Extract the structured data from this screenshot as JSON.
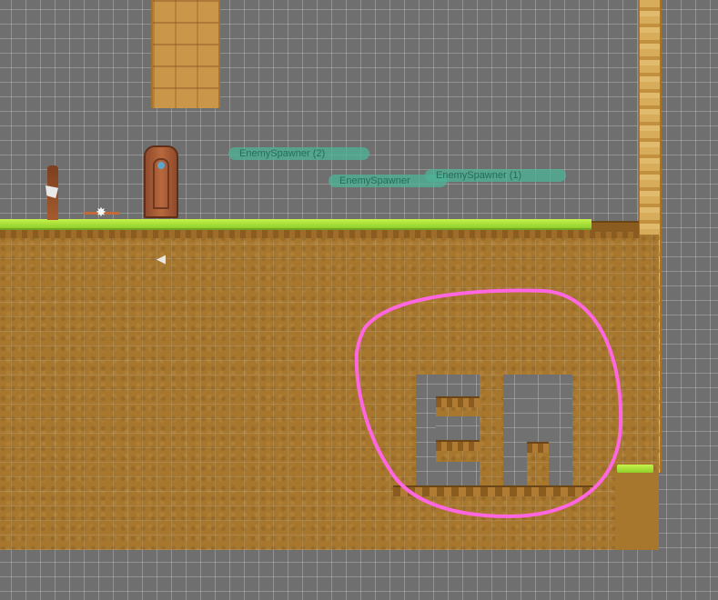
{
  "spawners": [
    {
      "label": "EnemySpawner (2)"
    },
    {
      "label": "EnemySpawner"
    },
    {
      "label": "EnemySpawner (1)"
    }
  ],
  "icons": {
    "door": "door-icon",
    "totem": "totem-icon",
    "gizmo": "light-gizmo-icon",
    "audio": "audio-source-icon"
  },
  "colors": {
    "grass": "#a8e03a",
    "dirt": "#a8772e",
    "background": "#6f6f6f",
    "spawner": "#4eb296",
    "annotation": "#ff66e0"
  }
}
